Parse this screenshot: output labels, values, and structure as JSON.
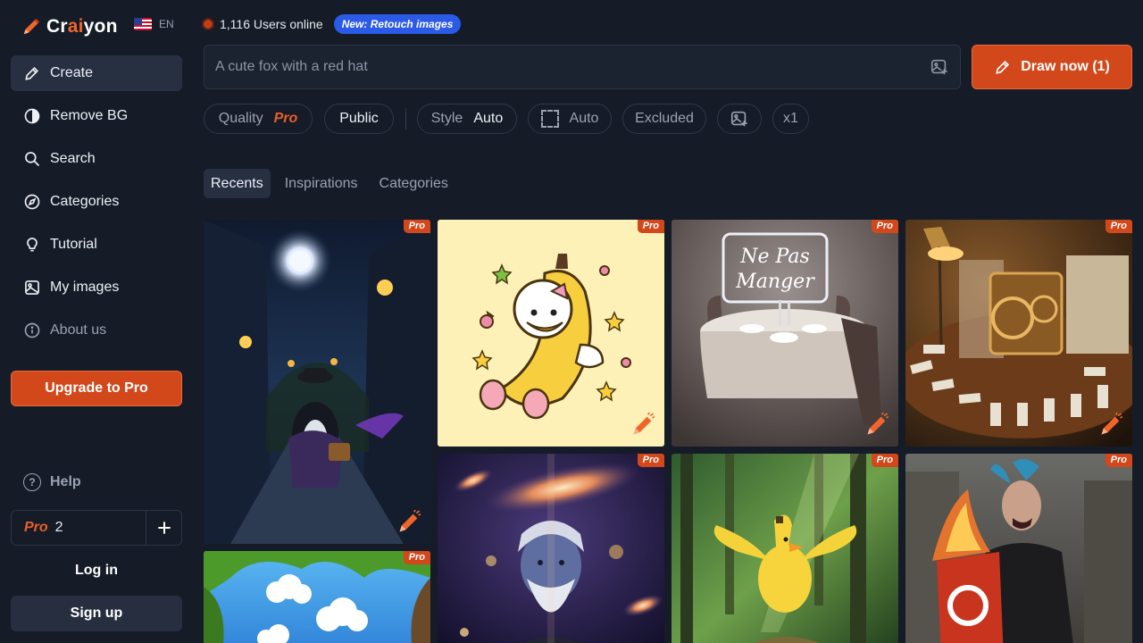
{
  "brand": {
    "name_pre": "Cr",
    "name_ai": "ai",
    "name_post": "yon",
    "lang": "EN"
  },
  "sidebar": {
    "items": [
      {
        "label": "Create",
        "icon": "pencil-icon",
        "active": true
      },
      {
        "label": "Remove BG",
        "icon": "half-circle-icon"
      },
      {
        "label": "Search",
        "icon": "search-icon"
      },
      {
        "label": "Categories",
        "icon": "compass-icon"
      },
      {
        "label": "Tutorial",
        "icon": "lightbulb-icon"
      },
      {
        "label": "My images",
        "icon": "image-icon"
      },
      {
        "label": "About us",
        "icon": "info-icon",
        "muted": true
      }
    ],
    "upgrade_label": "Upgrade to Pro",
    "help_label": "Help",
    "credits_tier": "Pro",
    "credits_count": "2",
    "login_label": "Log in",
    "signup_label": "Sign up"
  },
  "status": {
    "users_online": "1,116 Users online",
    "badge": "New: Retouch images"
  },
  "prompt": {
    "placeholder": "A cute fox with a red hat",
    "draw_label": "Draw now (1)"
  },
  "options": {
    "quality_label": "Quality",
    "quality_value": "Pro",
    "visibility": "Public",
    "style_label": "Style",
    "style_value": "Auto",
    "ratio_value": "Auto",
    "excluded_label": "Excluded",
    "count_label": "x1"
  },
  "tabs": [
    "Recents",
    "Inspirations",
    "Categories"
  ],
  "gallery": {
    "pro_tag": "Pro",
    "tiles": [
      {
        "name": "penguin-detective-image"
      },
      {
        "name": "banana-duck-image"
      },
      {
        "name": "ne-pas-manger-table-image",
        "text1": "Ne Pas",
        "text2": "Manger"
      },
      {
        "name": "domino-machine-image"
      },
      {
        "name": "galaxy-old-man-image"
      },
      {
        "name": "banana-bird-forest-image"
      },
      {
        "name": "punk-flag-image"
      },
      {
        "name": "cloud-tree-image"
      }
    ]
  },
  "colors": {
    "accent": "#d2481b",
    "badge_blue": "#2b5ae6",
    "background": "#151b27"
  }
}
